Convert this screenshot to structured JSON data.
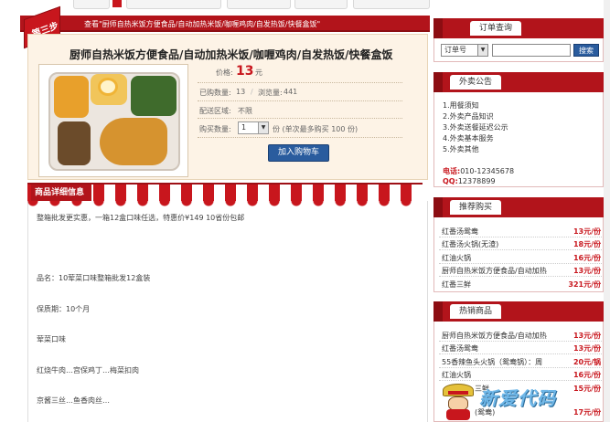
{
  "step": {
    "badge": "第三步",
    "crumb": "查看\"厨师自热米饭方便食品/自动加热米饭/咖喱鸡肉/自发热饭/快餐盒饭\""
  },
  "product": {
    "title": "厨师自热米饭方便食品/自动加热米饭/咖喱鸡肉/自发热饭/快餐盒饭",
    "price_label": "价格:",
    "price": "13",
    "price_unit": "元",
    "sold_label": "已购数量:",
    "sold": "13",
    "views_label": "浏览量:",
    "views": "441",
    "area_label": "配送区域:",
    "area": "不限",
    "qty_label": "购买数量:",
    "qty_value": "1",
    "qty_note": "份 (单次最多购买 100 份)",
    "add_cart": "加入购物车"
  },
  "detail": {
    "tab": "商品详细信息",
    "lines": [
      "整箱批发更实惠，一箱12盒口味任选，特惠价¥149 10省份包邮",
      "品名：10荤菜口味整箱批发12盒装",
      "保质期：10个月",
      "荤菜口味",
      "红烧牛肉…宫保鸡丁…梅菜扣肉",
      "京酱三丝…鱼香肉丝…"
    ]
  },
  "order_query": {
    "title": "订单查询",
    "select": "订单号",
    "search_btn": "搜索"
  },
  "notice": {
    "title": "外卖公告",
    "items": [
      "1.用餐须知",
      "2.外卖产品知识",
      "3.外卖送餐延迟公示",
      "4.外卖基本服务",
      "5.外卖其他"
    ],
    "phone_label": "电话:",
    "phone": "010-12345678",
    "qq_label": "QQ:",
    "qq": "12378899"
  },
  "recommend": {
    "title": "推荐购买",
    "items": [
      {
        "name": "红番汤鸳鸯",
        "price": "13元/份"
      },
      {
        "name": "红番汤火锅(无渣)",
        "price": "18元/份"
      },
      {
        "name": "红油火锅",
        "price": "16元/份"
      },
      {
        "name": "厨师自热米饭方便食品/自动加热",
        "price": "13元/份"
      },
      {
        "name": "红番三鲜",
        "price": "321元/份"
      }
    ]
  },
  "hot": {
    "title": "热销商品",
    "items": [
      {
        "name": "厨师自热米饭方便食品/自动加热",
        "price": "13元/份"
      },
      {
        "name": "红番汤鸳鸯",
        "price": "13元/份"
      },
      {
        "name": "55香辣鱼头火锅（鸳鸯锅）：周",
        "price": "20元/锅"
      },
      {
        "name": "红油火锅",
        "price": "16元/份"
      },
      {
        "name": "三鲜",
        "price": "15元/份"
      },
      {
        "name": "(鸳鸯)",
        "price": "17元/份"
      }
    ]
  },
  "watermark": "新爱代码"
}
